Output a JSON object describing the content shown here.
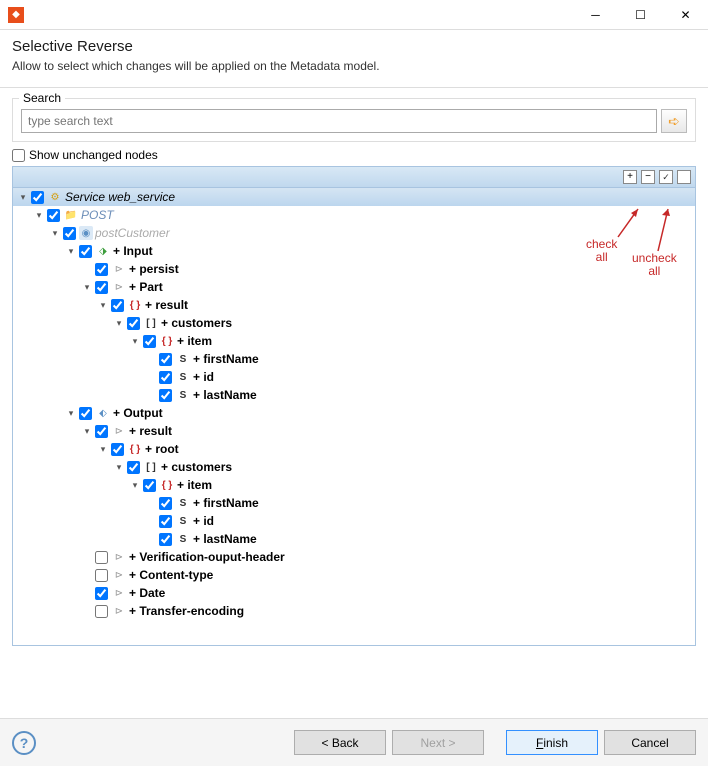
{
  "window": {
    "title": ""
  },
  "header": {
    "title": "Selective Reverse",
    "desc": "Allow to select which changes will be applied on the Metadata model."
  },
  "search": {
    "group_label": "Search",
    "placeholder": "type search text",
    "show_unchanged_label": "Show unchanged nodes"
  },
  "toolbar": {
    "expand_all": "+",
    "collapse_all": "−",
    "check_all": "",
    "uncheck_all": ""
  },
  "annotations": {
    "check_all": "check\nall",
    "uncheck_all": "uncheck\nall"
  },
  "tree": [
    {
      "depth": 0,
      "expanded": true,
      "checked": true,
      "icon": "service",
      "iconTxt": "⚙",
      "label": "Service web_service",
      "italic": true,
      "selected": true
    },
    {
      "depth": 1,
      "expanded": true,
      "checked": true,
      "icon": "folder",
      "iconTxt": "📁",
      "label": "POST",
      "italic": true,
      "blue": true
    },
    {
      "depth": 2,
      "expanded": true,
      "checked": true,
      "icon": "op",
      "iconTxt": "◉",
      "label": "postCustomer",
      "italic": true,
      "gray": true
    },
    {
      "depth": 3,
      "expanded": true,
      "checked": true,
      "icon": "input",
      "iconTxt": "⬗",
      "label": "+ Input",
      "bold": true
    },
    {
      "depth": 4,
      "expanded": false,
      "leaf": true,
      "checked": true,
      "icon": "param",
      "iconTxt": "⊳",
      "label": "+ persist",
      "bold": true
    },
    {
      "depth": 4,
      "expanded": true,
      "checked": true,
      "icon": "param",
      "iconTxt": "⊳",
      "label": "+ Part",
      "bold": true
    },
    {
      "depth": 5,
      "expanded": true,
      "checked": true,
      "icon": "braces",
      "iconTxt": "{ }",
      "label": "+ result",
      "bold": true
    },
    {
      "depth": 6,
      "expanded": true,
      "checked": true,
      "icon": "bracket",
      "iconTxt": "[ ]",
      "label": "+ customers",
      "bold": true
    },
    {
      "depth": 7,
      "expanded": true,
      "checked": true,
      "icon": "braces",
      "iconTxt": "{ }",
      "label": "+ item",
      "bold": true
    },
    {
      "depth": 8,
      "expanded": false,
      "leaf": true,
      "checked": true,
      "icon": "str",
      "iconTxt": "S",
      "label": "+ firstName",
      "bold": true
    },
    {
      "depth": 8,
      "expanded": false,
      "leaf": true,
      "checked": true,
      "icon": "str",
      "iconTxt": "S",
      "label": "+ id",
      "bold": true
    },
    {
      "depth": 8,
      "expanded": false,
      "leaf": true,
      "checked": true,
      "icon": "str",
      "iconTxt": "S",
      "label": "+ lastName",
      "bold": true
    },
    {
      "depth": 3,
      "expanded": true,
      "checked": true,
      "icon": "output",
      "iconTxt": "⬖",
      "label": "+ Output",
      "bold": true
    },
    {
      "depth": 4,
      "expanded": true,
      "checked": true,
      "icon": "param",
      "iconTxt": "⊳",
      "label": "+ result",
      "bold": true
    },
    {
      "depth": 5,
      "expanded": true,
      "checked": true,
      "icon": "braces",
      "iconTxt": "{ }",
      "label": "+ root",
      "bold": true
    },
    {
      "depth": 6,
      "expanded": true,
      "checked": true,
      "icon": "bracket",
      "iconTxt": "[ ]",
      "label": "+ customers",
      "bold": true
    },
    {
      "depth": 7,
      "expanded": true,
      "checked": true,
      "icon": "braces",
      "iconTxt": "{ }",
      "label": "+ item",
      "bold": true
    },
    {
      "depth": 8,
      "expanded": false,
      "leaf": true,
      "checked": true,
      "icon": "str",
      "iconTxt": "S",
      "label": "+ firstName",
      "bold": true
    },
    {
      "depth": 8,
      "expanded": false,
      "leaf": true,
      "checked": true,
      "icon": "str",
      "iconTxt": "S",
      "label": "+ id",
      "bold": true
    },
    {
      "depth": 8,
      "expanded": false,
      "leaf": true,
      "checked": true,
      "icon": "str",
      "iconTxt": "S",
      "label": "+ lastName",
      "bold": true
    },
    {
      "depth": 4,
      "expanded": false,
      "leaf": true,
      "checked": false,
      "icon": "param",
      "iconTxt": "⊳",
      "label": "+ Verification-ouput-header",
      "bold": true
    },
    {
      "depth": 4,
      "expanded": false,
      "leaf": true,
      "checked": false,
      "icon": "param",
      "iconTxt": "⊳",
      "label": "+ Content-type",
      "bold": true
    },
    {
      "depth": 4,
      "expanded": false,
      "leaf": true,
      "checked": true,
      "icon": "param",
      "iconTxt": "⊳",
      "label": "+ Date",
      "bold": true
    },
    {
      "depth": 4,
      "expanded": false,
      "leaf": true,
      "checked": false,
      "icon": "param",
      "iconTxt": "⊳",
      "label": "+ Transfer-encoding",
      "bold": true
    }
  ],
  "buttons": {
    "back": "< Back",
    "next": "Next >",
    "finish": "Finish",
    "cancel": "Cancel"
  }
}
